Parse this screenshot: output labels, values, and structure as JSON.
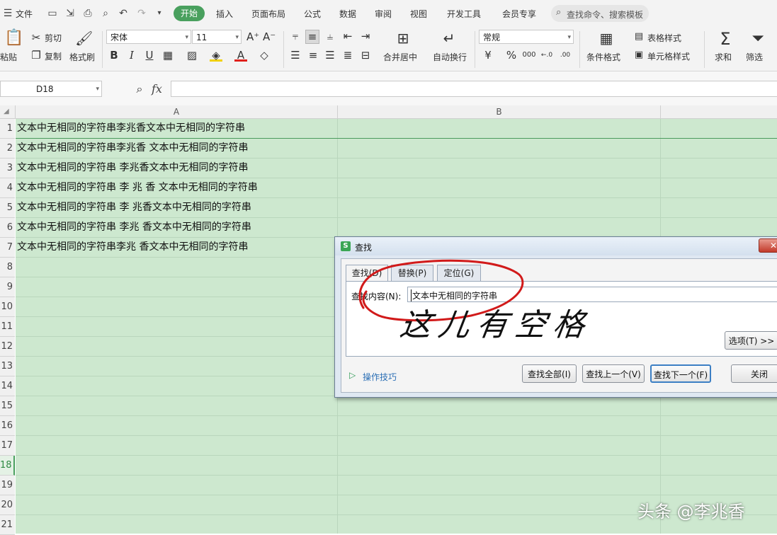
{
  "menubar": {
    "file": "文件",
    "tabs": [
      "开始",
      "插入",
      "页面布局",
      "公式",
      "数据",
      "审阅",
      "视图",
      "开发工具",
      "会员专享"
    ],
    "search_placeholder": "查找命令、搜索模板"
  },
  "ribbon": {
    "paste": "粘贴",
    "cut": "剪切",
    "copy": "复制",
    "format_painter": "格式刷",
    "font_name": "宋体",
    "font_size": "11",
    "bold": "B",
    "italic": "I",
    "underline": "U",
    "font_color_glyph": "A",
    "grow_font": "A⁺",
    "shrink_font": "A⁻",
    "merge_center": "合并居中",
    "wrap_text": "自动换行",
    "number_format": "常规",
    "currency": "¥",
    "percent": "%",
    "thousands": "000",
    "inc_decimal": "←.0",
    "dec_decimal": ".00",
    "conditional_format": "条件格式",
    "table_style": "表格样式",
    "cell_style": "单元格样式",
    "sum": "求和",
    "filter": "筛选"
  },
  "formula_bar": {
    "name_box": "D18",
    "fx": "fx",
    "formula": ""
  },
  "columns": [
    "A",
    "B"
  ],
  "rows": [
    "1",
    "2",
    "3",
    "4",
    "5",
    "6",
    "7",
    "8",
    "9",
    "10",
    "11",
    "12",
    "13",
    "14",
    "15",
    "16",
    "17",
    "18",
    "19",
    "20",
    "21"
  ],
  "cells": [
    "文本中无相同的字符串李兆香文本中无相同的字符串",
    "文本中无相同的字符串李兆香 文本中无相同的字符串",
    "文本中无相同的字符串 李兆香文本中无相同的字符串",
    "文本中无相同的字符串 李 兆 香 文本中无相同的字符串",
    "文本中无相同的字符串 李 兆香文本中无相同的字符串",
    "文本中无相同的字符串 李兆 香文本中无相同的字符串",
    "文本中无相同的字符串李兆 香文本中无相同的字符串"
  ],
  "dialog": {
    "title": "查找",
    "tabs": [
      "查找(D)",
      "替换(P)",
      "定位(G)"
    ],
    "find_label": "查找内容(N):",
    "find_value": "文本中无相同的字符串",
    "options_button": "选项(T) >>",
    "tips_link": "操作技巧",
    "find_all": "查找全部(I)",
    "find_prev": "查找上一个(V)",
    "find_next": "查找下一个(F)",
    "close": "关闭",
    "handwritten_note": "这儿有空格"
  },
  "watermark": "头条 @李兆香",
  "colors": {
    "accent": "#49a05e",
    "grid_fill": "#cde8cf",
    "annotation_red": "#d11a1a"
  }
}
